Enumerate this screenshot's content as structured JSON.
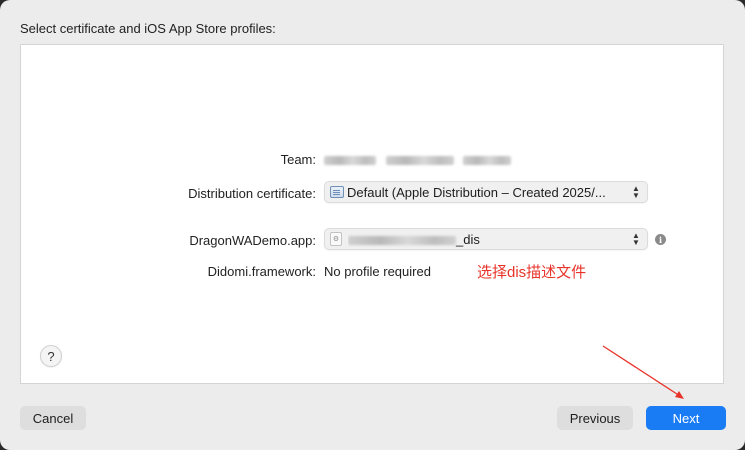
{
  "dialog": {
    "title": "Select certificate and iOS App Store profiles:"
  },
  "fields": {
    "team_label": "Team:",
    "dist_cert_label": "Distribution certificate:",
    "dist_cert_value": "Default (Apple Distribution – Created 2025/...",
    "app_label": "DragonWADemo.app:",
    "app_profile_value_suffix": "_dis",
    "framework_label": "Didomi.framework:",
    "framework_value": "No profile required"
  },
  "annotation": {
    "text": "选择dis描述文件",
    "color": "#e8332a"
  },
  "buttons": {
    "help": "?",
    "cancel": "Cancel",
    "previous": "Previous",
    "next": "Next"
  },
  "icons": {
    "cert": "certificate-icon",
    "profile": "provisioning-profile-icon",
    "chevron": "updown-chevron-icon",
    "info": "info-icon"
  },
  "colors": {
    "accent": "#1a7cf5",
    "annotation": "#e8332a",
    "background": "#ececec"
  }
}
